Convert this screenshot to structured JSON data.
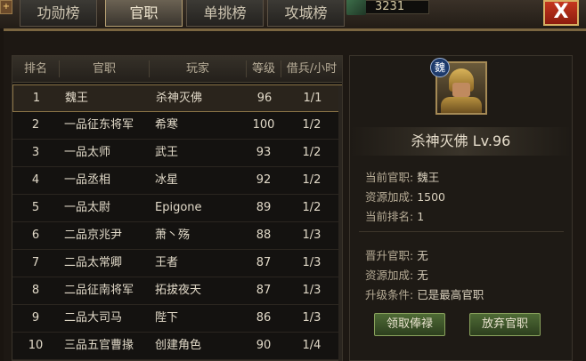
{
  "tabs": [
    {
      "label": "功勋榜"
    },
    {
      "label": "官职"
    },
    {
      "label": "单挑榜"
    },
    {
      "label": "攻城榜"
    }
  ],
  "resource": {
    "value": "3231"
  },
  "close": {
    "label": "X"
  },
  "ranking": {
    "headers": [
      "排名",
      "官职",
      "玩家",
      "等级",
      "借兵/小时"
    ],
    "rows": [
      {
        "rank": "1",
        "title": "魏王",
        "player": "杀神灭佛",
        "level": "96",
        "troops": "1/1"
      },
      {
        "rank": "2",
        "title": "一品征东将军",
        "player": "希寒",
        "level": "100",
        "troops": "1/2"
      },
      {
        "rank": "3",
        "title": "一品太师",
        "player": "武王",
        "level": "93",
        "troops": "1/2"
      },
      {
        "rank": "4",
        "title": "一品丞相",
        "player": "冰星",
        "level": "92",
        "troops": "1/2"
      },
      {
        "rank": "5",
        "title": "一品太尉",
        "player": "Epigone",
        "level": "89",
        "troops": "1/2"
      },
      {
        "rank": "6",
        "title": "二品京兆尹",
        "player": "萧丶殇",
        "level": "88",
        "troops": "1/3"
      },
      {
        "rank": "7",
        "title": "二品太常卿",
        "player": "王者",
        "level": "87",
        "troops": "1/3"
      },
      {
        "rank": "8",
        "title": "二品征南将军",
        "player": "拓拔夜天",
        "level": "87",
        "troops": "1/3"
      },
      {
        "rank": "9",
        "title": "二品大司马",
        "player": "陛下",
        "level": "86",
        "troops": "1/3"
      },
      {
        "rank": "10",
        "title": "三品五官曹掾",
        "player": "创建角色",
        "level": "90",
        "troops": "1/4"
      }
    ]
  },
  "detail": {
    "faction": "魏",
    "name_level": "杀神灭佛  Lv.96",
    "current_title_label": "当前官职:",
    "current_title": "魏王",
    "resource_bonus_label": "资源加成:",
    "resource_bonus": "1500",
    "current_rank_label": "当前排名:",
    "current_rank": "1",
    "promote_title_label": "晋升官职:",
    "promote_title": "无",
    "promote_bonus_label": "资源加成:",
    "promote_bonus": "无",
    "upgrade_label": "升级条件:",
    "upgrade_value": "已是最高官职",
    "collect_button": "领取俸禄",
    "abandon_button": "放弃官职"
  }
}
